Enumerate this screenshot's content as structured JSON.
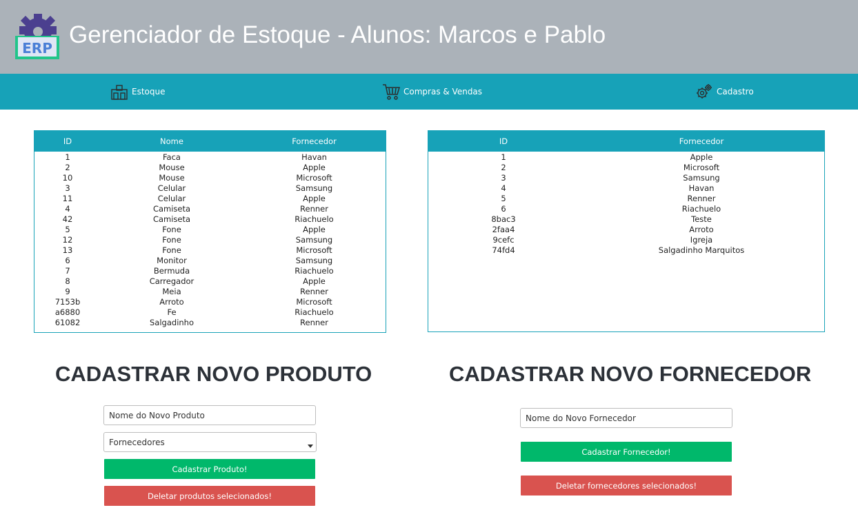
{
  "header": {
    "title": "Gerenciador de Estoque - Alunos: Marcos e Pablo",
    "logo_text": "ERP",
    "logo_icon": "erp-gear-logo"
  },
  "nav": {
    "items": [
      {
        "label": "Estoque",
        "icon": "warehouse-icon"
      },
      {
        "label": "Compras & Vendas",
        "icon": "cart-icon"
      },
      {
        "label": "Cadastro",
        "icon": "gears-icon"
      }
    ]
  },
  "products_table": {
    "headers": [
      "ID",
      "Nome",
      "Fornecedor"
    ],
    "rows": [
      [
        "1",
        "Faca",
        "Havan"
      ],
      [
        "2",
        "Mouse",
        "Apple"
      ],
      [
        "10",
        "Mouse",
        "Microsoft"
      ],
      [
        "3",
        "Celular",
        "Samsung"
      ],
      [
        "11",
        "Celular",
        "Apple"
      ],
      [
        "4",
        "Camiseta",
        "Renner"
      ],
      [
        "42",
        "Camiseta",
        "Riachuelo"
      ],
      [
        "5",
        "Fone",
        "Apple"
      ],
      [
        "12",
        "Fone",
        "Samsung"
      ],
      [
        "13",
        "Fone",
        "Microsoft"
      ],
      [
        "6",
        "Monitor",
        "Samsung"
      ],
      [
        "7",
        "Bermuda",
        "Riachuelo"
      ],
      [
        "8",
        "Carregador",
        "Apple"
      ],
      [
        "9",
        "Meia",
        "Renner"
      ],
      [
        "7153b",
        "Arroto",
        "Microsoft"
      ],
      [
        "a6880",
        "Fe",
        "Riachuelo"
      ],
      [
        "61082",
        "Salgadinho",
        "Renner"
      ]
    ]
  },
  "suppliers_table": {
    "headers": [
      "ID",
      "Fornecedor"
    ],
    "rows": [
      [
        "1",
        "Apple"
      ],
      [
        "2",
        "Microsoft"
      ],
      [
        "3",
        "Samsung"
      ],
      [
        "4",
        "Havan"
      ],
      [
        "5",
        "Renner"
      ],
      [
        "6",
        "Riachuelo"
      ],
      [
        "8bac3",
        "Teste"
      ],
      [
        "2faa4",
        "Arroto"
      ],
      [
        "9cefc",
        "Igreja"
      ],
      [
        "74fd4",
        "Salgadinho Marquitos"
      ]
    ]
  },
  "product_form": {
    "title": "CADASTRAR NOVO PRODUTO",
    "name_placeholder": "Nome do Novo Produto",
    "supplier_select": "Fornecedores",
    "submit_label": "Cadastrar Produto!",
    "delete_label": "Deletar produtos selecionados!"
  },
  "supplier_form": {
    "title": "CADASTRAR NOVO FORNECEDOR",
    "name_placeholder": "Nome do Novo Fornecedor",
    "submit_label": "Cadastrar Fornecedor!",
    "delete_label": "Deletar fornecedores selecionados!"
  },
  "colors": {
    "header_bg": "#abb2b9",
    "nav_bg": "#17a2b8",
    "success": "#00b86b",
    "danger": "#d9534f"
  }
}
